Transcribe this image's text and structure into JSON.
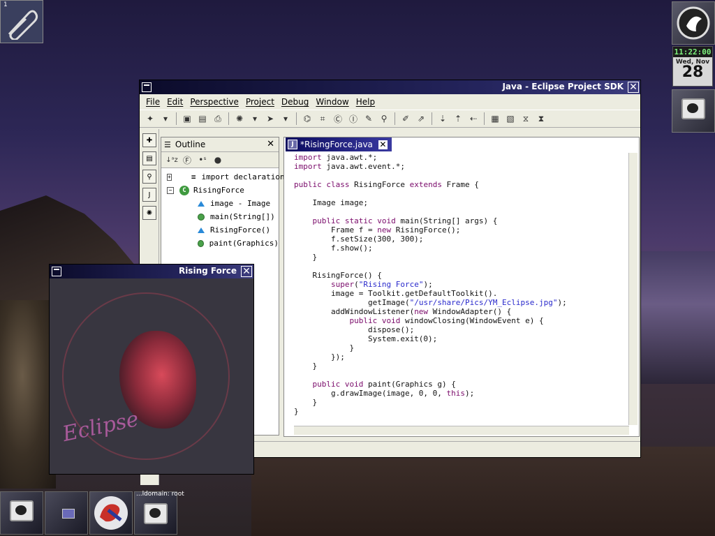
{
  "pager": {
    "number": "1"
  },
  "clock": {
    "time": "11:22:00",
    "date": "Wed, Nov",
    "day": "28"
  },
  "eclipse": {
    "title": "Java - Eclipse Project SDK",
    "menu": [
      "File",
      "Edit",
      "Perspective",
      "Project",
      "Debug",
      "Window",
      "Help"
    ],
    "outline": {
      "title": "Outline",
      "items": [
        {
          "label": "import declarations",
          "kind": "imports"
        },
        {
          "label": "RisingForce",
          "kind": "class"
        },
        {
          "label": "image - Image",
          "kind": "field"
        },
        {
          "label": "main(String[])",
          "kind": "static-method",
          "badge": "S"
        },
        {
          "label": "RisingForce()",
          "kind": "constructor"
        },
        {
          "label": "paint(Graphics)",
          "kind": "method"
        }
      ]
    },
    "editor": {
      "tab_label": "*RisingForce.java",
      "tab_close": "✕"
    }
  },
  "viewer": {
    "title": "Rising Force",
    "signature": "Eclipse"
  },
  "taskbar": {
    "tile4_label": "...ldomain: root"
  },
  "icons": {
    "close": "close-icon",
    "window_menu": "window-menu-icon"
  }
}
